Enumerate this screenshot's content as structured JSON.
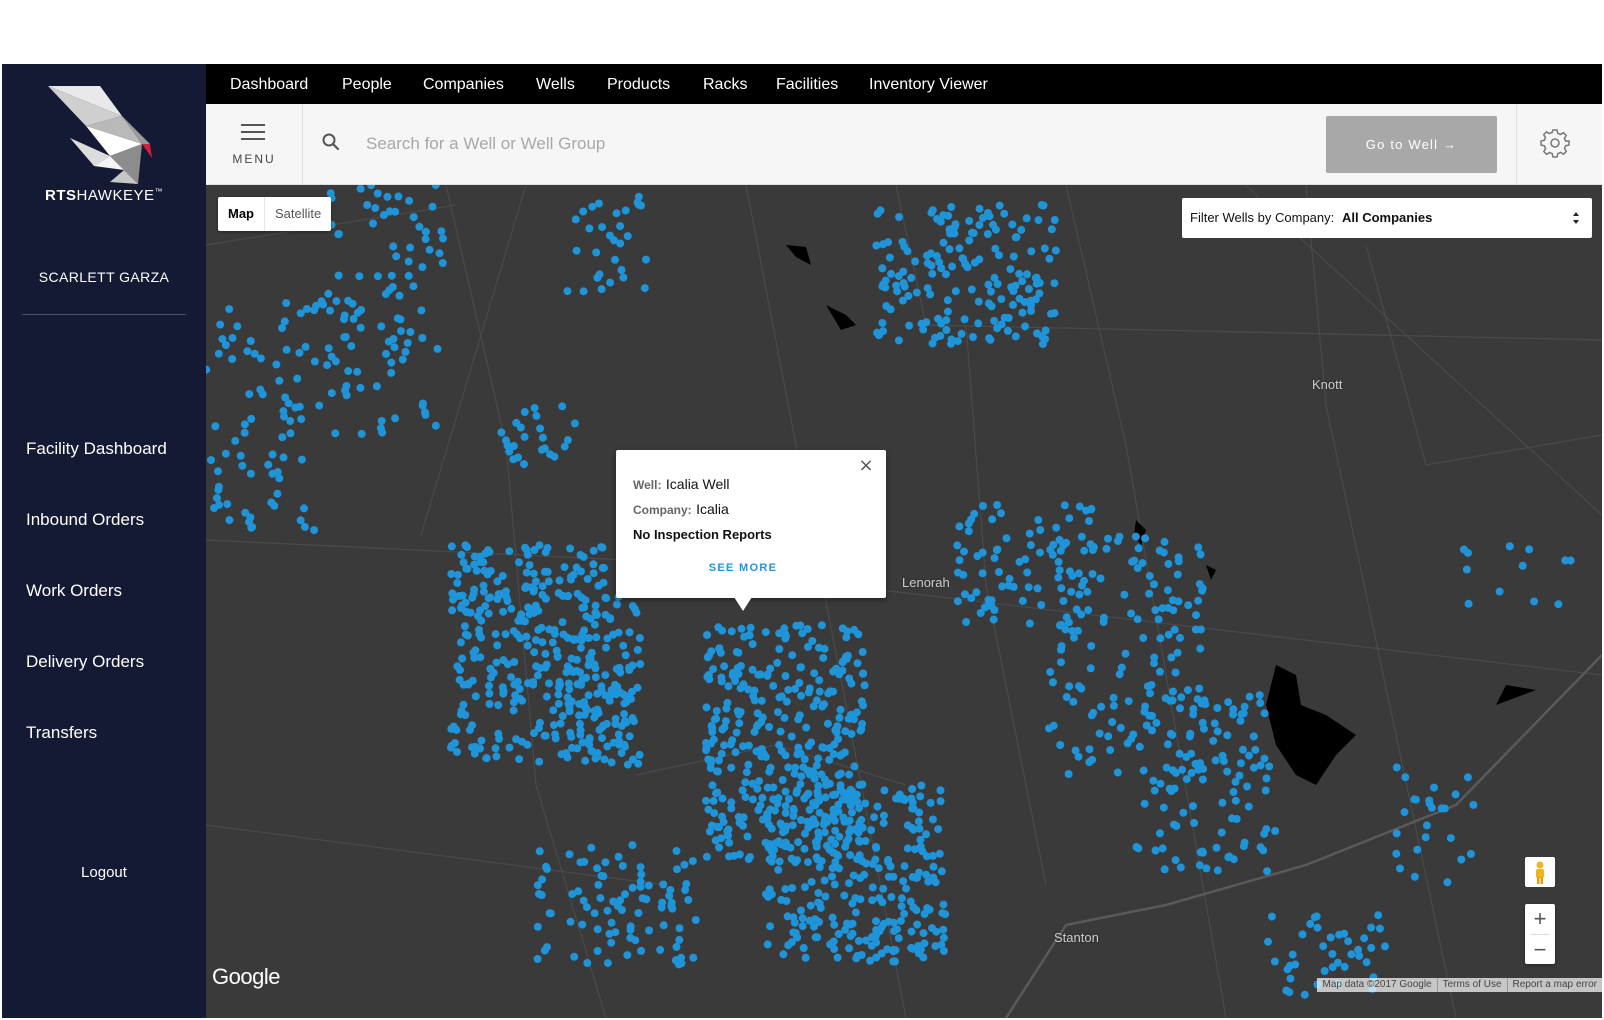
{
  "sidebar": {
    "brand_bold": "RTS",
    "brand_light": "HAWKEYE",
    "brand_tm": "™",
    "user_name": "SCARLETT GARZA",
    "items": [
      {
        "label": "Facility Dashboard"
      },
      {
        "label": "Inbound Orders"
      },
      {
        "label": "Work Orders"
      },
      {
        "label": "Delivery Orders"
      },
      {
        "label": "Transfers"
      }
    ],
    "logout": "Logout"
  },
  "topnav": {
    "items": [
      {
        "label": "Dashboard"
      },
      {
        "label": "People"
      },
      {
        "label": "Companies"
      },
      {
        "label": "Wells"
      },
      {
        "label": "Products"
      },
      {
        "label": "Racks"
      },
      {
        "label": "Facilities"
      },
      {
        "label": "Inventory Viewer"
      }
    ]
  },
  "searchbar": {
    "menu_label": "MENU",
    "placeholder": "Search for a Well or Well Group",
    "value": "",
    "go_button": "Go to Well →"
  },
  "map": {
    "map_types": {
      "map": "Map",
      "satellite": "Satellite",
      "selected": "Map"
    },
    "filter": {
      "label": "Filter Wells by Company:",
      "value": "All Companies"
    },
    "places": {
      "knott": "Knott",
      "lenorah": "Lenorah",
      "stanton": "Stanton"
    },
    "popup": {
      "well_key": "Well:",
      "well_value": "Icalia Well",
      "company_key": "Company:",
      "company_value": "Icalia",
      "note": "No Inspection Reports",
      "see_more": "SEE MORE",
      "close": "×"
    },
    "zoom_in": "+",
    "zoom_out": "−",
    "google_logo": "Google",
    "attribution": {
      "data": "Map data ©2017 Google",
      "terms": "Terms of Use",
      "report": "Report a map error"
    },
    "colors": {
      "background": "#3a3a3a",
      "well_marker": "#1f94d8",
      "water": "#000000"
    }
  },
  "colors": {
    "sidebar": "#141a33",
    "topnav": "#000000",
    "go_button": "#a8a8a8",
    "accent": "#1f94d8"
  },
  "icons": {
    "menu": "hamburger-icon",
    "search": "search-icon",
    "settings": "gear-icon",
    "pegman": "pegman-icon",
    "dropdown": "sort-arrows-icon"
  }
}
